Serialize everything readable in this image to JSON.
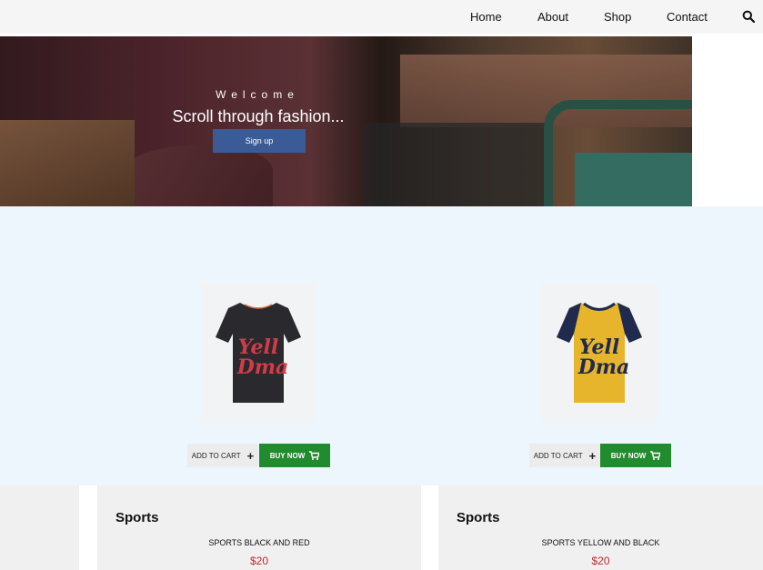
{
  "nav": {
    "links": [
      "Home",
      "About",
      "Shop",
      "Contact"
    ],
    "search_icon": "search-icon"
  },
  "hero": {
    "welcome": "Welcome",
    "title": "Scroll through fashion...",
    "button": "Sign up"
  },
  "products": [
    {
      "shirt_color": "#2a2a2e",
      "print_color": "#d23b47",
      "add_to_cart": "ADD TO CART",
      "buy_now": "BUY NOW"
    },
    {
      "shirt_color": "#e7b52c",
      "print_color": "#1f2a4e",
      "add_to_cart": "ADD TO CART",
      "buy_now": "BUY NOW"
    }
  ],
  "cards": [
    {
      "category": "Sports",
      "name": "SPORTS BLACK AND RED",
      "price": "$20"
    },
    {
      "category": "Sports",
      "name": "SPORTS YELLOW AND BLACK",
      "price": "$20"
    }
  ],
  "colors": {
    "buy_button": "#218c2e",
    "signup_button": "#3b5b96",
    "price": "#c0282e",
    "section_bg": "#eef6fd"
  }
}
